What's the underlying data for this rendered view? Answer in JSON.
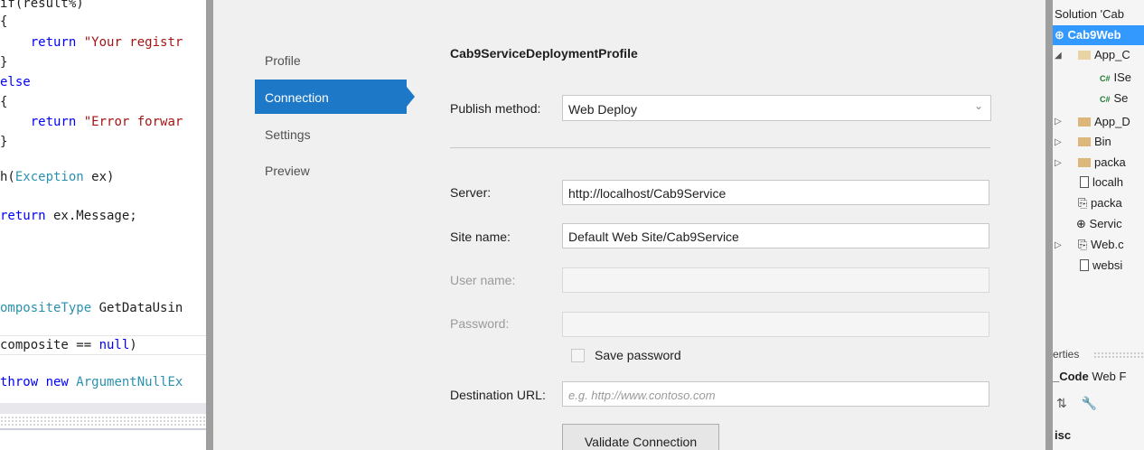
{
  "code_editor": {
    "lines": [
      {
        "pre": "if(result%)",
        "kw": "",
        "rest": ""
      },
      {
        "pre": "{",
        "kw": "",
        "rest": ""
      },
      {
        "pre": "    ",
        "kw": "return",
        "rest": " \"Your registr"
      },
      {
        "pre": "}",
        "kw": "",
        "rest": ""
      },
      {
        "pre": "else",
        "kw": "",
        "rest": ""
      },
      {
        "pre": "{",
        "kw": "",
        "rest": ""
      },
      {
        "pre": "    ",
        "kw": "return",
        "rest": " \"Error forwar"
      },
      {
        "pre": "}",
        "kw": "",
        "rest": ""
      },
      {
        "pre": "h(",
        "kw": "Exception",
        "rest": " ex)"
      },
      {
        "pre": "",
        "kw": "return",
        "rest": " ex.Message;"
      },
      {
        "pre": "",
        "kw": "ompositeType",
        "rest": " GetDataUsin"
      },
      {
        "pre": "composite == ",
        "kw": "null",
        "rest": ")"
      },
      {
        "pre": "throw ",
        "kw": "new",
        "rest": " ArgumentNullEx"
      }
    ]
  },
  "dialog": {
    "nav": [
      "Profile",
      "Connection",
      "Settings",
      "Preview"
    ],
    "profile_name": "Cab9ServiceDeploymentProfile",
    "publish_method_label": "Publish method:",
    "publish_method_value": "Web Deploy",
    "server_label": "Server:",
    "server_value": "http://localhost/Cab9Service",
    "site_name_label": "Site name:",
    "site_name_value": "Default Web Site/Cab9Service",
    "user_name_label": "User name:",
    "user_name_value": "",
    "password_label": "Password:",
    "password_value": "",
    "save_password_label": "Save password",
    "save_password_checked": false,
    "destination_url_label": "Destination URL:",
    "destination_url_placeholder": "e.g. http://www.contoso.com",
    "validate_button": "Validate Connection"
  },
  "solution_explorer": {
    "header": "Solution 'Cab",
    "items": [
      {
        "label": "Cab9Web",
        "kind": "project",
        "selected": true
      },
      {
        "label": "App_C",
        "kind": "folder-open"
      },
      {
        "label": "ISe",
        "kind": "cs"
      },
      {
        "label": "Se",
        "kind": "cs"
      },
      {
        "label": "App_D",
        "kind": "folder"
      },
      {
        "label": "Bin",
        "kind": "folder"
      },
      {
        "label": "packa",
        "kind": "folder"
      },
      {
        "label": "localh",
        "kind": "file"
      },
      {
        "label": "packa",
        "kind": "config"
      },
      {
        "label": "Servic",
        "kind": "service"
      },
      {
        "label": "Web.c",
        "kind": "config"
      },
      {
        "label": "websi",
        "kind": "file"
      }
    ],
    "properties_title": "erties",
    "properties_item_bold": "_Code",
    "properties_item_rest": " Web F",
    "properties_section": "isc"
  },
  "colors": {
    "accent": "#1e78c8",
    "selection": "#3399ff",
    "keyword": "#0000ff",
    "string": "#a31515",
    "type": "#2b91af"
  }
}
